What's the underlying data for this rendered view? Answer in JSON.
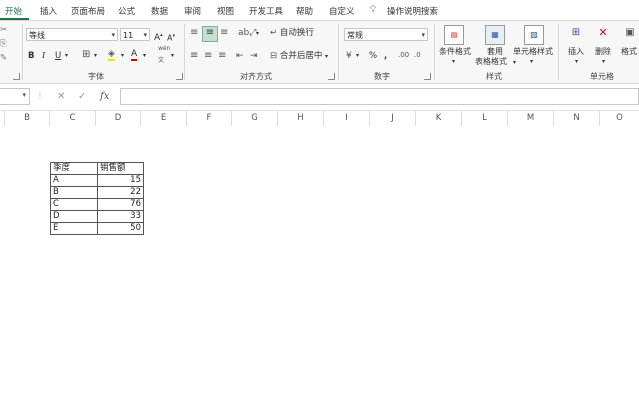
{
  "tabs": [
    {
      "label": "开始"
    },
    {
      "label": "插入"
    },
    {
      "label": "页面布局"
    },
    {
      "label": "公式"
    },
    {
      "label": "数据"
    },
    {
      "label": "审阅"
    },
    {
      "label": "视图"
    },
    {
      "label": "开发工具"
    },
    {
      "label": "帮助"
    },
    {
      "label": "自定义"
    },
    {
      "label": "操作说明搜索"
    }
  ],
  "ribbon": {
    "font": {
      "name": "等线",
      "size": "11",
      "grow": "A",
      "shrink": "A",
      "bold": "B",
      "italic": "I",
      "underline": "U",
      "wen": "wén",
      "wen2": "文",
      "label": "字体"
    },
    "align": {
      "wrap": "自动换行",
      "merge": "合并后居中",
      "label": "对齐方式"
    },
    "number": {
      "format": "常规",
      "percent": "%",
      "comma": ",",
      "label": "数字"
    },
    "styles": {
      "cond": "条件格式",
      "table1": "套用",
      "table2": "表格格式",
      "cell": "单元格样式",
      "label": "样式"
    },
    "cells": {
      "insert": "插入",
      "delete": "删除",
      "format": "格式",
      "label": "单元格"
    }
  },
  "formula_bar": {
    "fx": "fx",
    "cancel": "✕",
    "enter": "✓",
    "value": ""
  },
  "columns": [
    "B",
    "C",
    "D",
    "E",
    "F",
    "G",
    "H",
    "I",
    "J",
    "K",
    "L",
    "M",
    "N",
    "O"
  ],
  "table": {
    "headers": [
      "季度",
      "销售额"
    ],
    "rows": [
      {
        "q": "A",
        "v": "15"
      },
      {
        "q": "B",
        "v": "22"
      },
      {
        "q": "C",
        "v": "76"
      },
      {
        "q": "D",
        "v": "33"
      },
      {
        "q": "E",
        "v": "50"
      }
    ]
  }
}
